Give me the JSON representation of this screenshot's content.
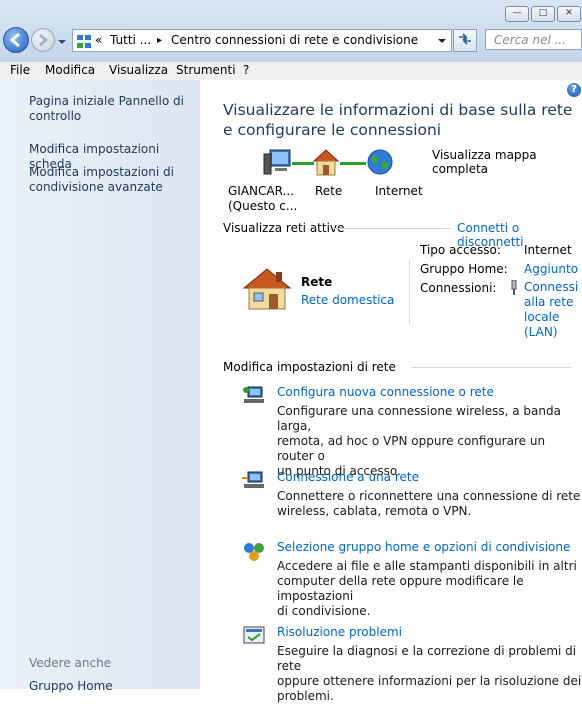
{
  "window": {
    "minimize_glyph": "—",
    "maximize_glyph": "□",
    "close_glyph": "✕"
  },
  "address": {
    "prefix": "«",
    "crumb1": "Tutti ...",
    "crumb2": "Centro connessioni di rete e condivisione",
    "separator": "▸"
  },
  "search": {
    "placeholder": "Cerca nel ..."
  },
  "menu": [
    "File",
    "Modifica",
    "Visualizza",
    "Strumenti",
    "?"
  ],
  "sidebar": {
    "items": [
      {
        "label": "Pagina iniziale Pannello di controllo"
      },
      {
        "label": "Modifica impostazioni scheda"
      },
      {
        "label": "Modifica impostazioni di condivisione avanzate"
      }
    ],
    "see_also_title": "Vedere anche",
    "see_also_items": [
      {
        "label": "Gruppo Home"
      }
    ]
  },
  "main": {
    "heading": "Visualizzare le informazioni di base sulla rete e configurare le connessioni",
    "map_link": "Visualizza mappa completa",
    "map": {
      "computer_line1": "GIANCAR...",
      "computer_line2": "(Questo c...",
      "network": "Rete",
      "internet": "Internet"
    },
    "active_title": "Visualizza reti attive",
    "connect_link": "Connetti o disconnetti",
    "network": {
      "name": "Rete",
      "type_link": "Rete domestica",
      "access_label": "Tipo accesso:",
      "access_value": "Internet",
      "homegroup_label": "Gruppo Home:",
      "homegroup_value": "Aggiunto",
      "connections_label": "Connessioni:",
      "connections_value": "Connessione alla rete locale (LAN)",
      "connections_lines": [
        "Connessi",
        "alla rete",
        "locale",
        "(LAN)"
      ]
    },
    "change_title": "Modifica impostazioni di rete",
    "tasks": [
      {
        "icon": "new-connection-icon",
        "title": "Configura nuova connessione o rete",
        "desc": [
          "Configurare una connessione wireless, a banda larga,",
          "remota, ad hoc o VPN oppure configurare un router o",
          "un punto di accesso."
        ]
      },
      {
        "icon": "connect-network-icon",
        "title": "Connessione a una rete",
        "desc": [
          "Connettere o riconnettere una connessione di rete",
          "wireless, cablata, remota o VPN."
        ]
      },
      {
        "icon": "homegroup-icon",
        "title": "Selezione gruppo home e opzioni di condivisione",
        "desc": [
          "Accedere ai file e alle stampanti disponibili in altri",
          "computer della rete oppure modificare le impostazioni",
          "di condivisione."
        ]
      },
      {
        "icon": "troubleshoot-icon",
        "title": "Risoluzione problemi",
        "desc": [
          "Eseguire la diagnosi e la correzione di problemi di rete",
          "oppure ottenere informazioni per la risoluzione dei",
          "problemi."
        ]
      }
    ]
  },
  "help_glyph": "?"
}
